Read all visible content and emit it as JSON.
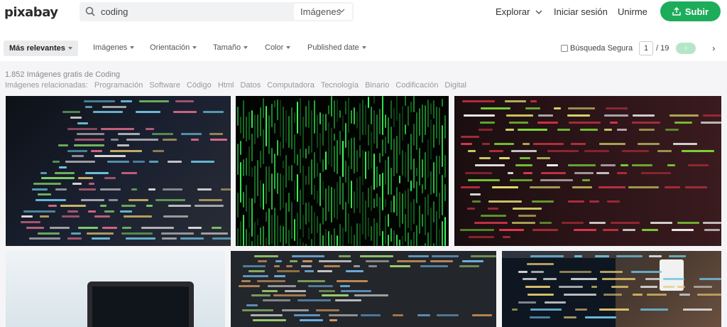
{
  "header": {
    "logo": "pixabay",
    "search": {
      "value": "coding",
      "type_label": "Imágenes"
    },
    "nav": {
      "explore": "Explorar",
      "login": "Iniciar sesión",
      "join": "Unirme"
    },
    "upload_label": "Subir"
  },
  "filters": {
    "sort": "Más relevantes",
    "items": [
      "Imágenes",
      "Orientación",
      "Tamaño",
      "Color",
      "Published date"
    ],
    "safe_search": "Búsqueda Segura",
    "page": {
      "current": "1",
      "total": "/ 19",
      "prev": "‹",
      "next": "›"
    }
  },
  "results": {
    "count_text": "1.852 Imágenes gratis de Coding",
    "related_label": "Imágenes relacionadas:",
    "related": [
      "Programación",
      "Software",
      "Código",
      "Html",
      "Datos",
      "Computadora",
      "Tecnología",
      "Binario",
      "Codificación",
      "Digital"
    ]
  },
  "colors": {
    "accent": "#1dad5a",
    "page_bg": "#f5f5f7"
  },
  "icons": {
    "search": "search-icon",
    "chevron": "chevron-down-icon",
    "upload": "upload-icon"
  }
}
